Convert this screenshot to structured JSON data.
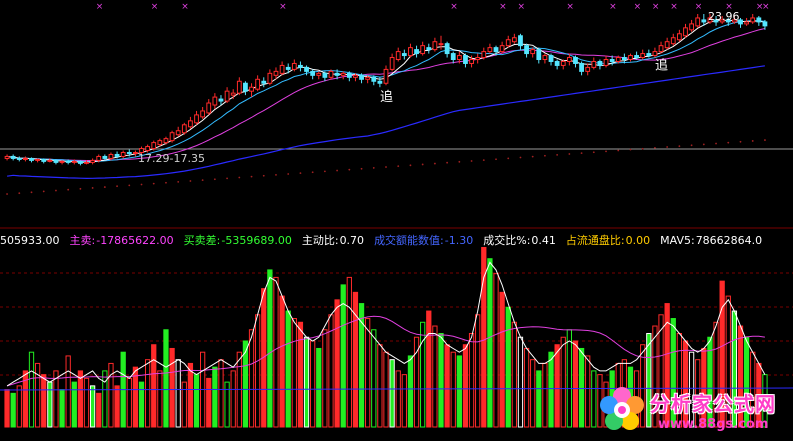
{
  "colors": {
    "up": "#ff2a2a",
    "down": "#55e6ff",
    "ma_white": "#ffffff",
    "ma_magenta": "#e040e0",
    "ma_blue": "#2a2aff",
    "ma_cyan": "#33bbff",
    "dots": "#a02020",
    "marker": "#e040e0",
    "label_white": "#ffffff",
    "label_magenta": "#ff44ff",
    "label_green": "#33ff33",
    "label_yellow": "#ffcc00",
    "label_blue": "#4466ff",
    "vol_green": "#22ee22",
    "vol_white": "#ffffff",
    "grid": "#7a0000"
  },
  "price_panel": {
    "annotations": [
      {
        "text": "追",
        "index": 62
      },
      {
        "text": "追",
        "index": 107
      }
    ],
    "range_label": "17.29-17.35",
    "high_label": "23.96"
  },
  "indicator_bar": {
    "items": [
      {
        "name": "prefix",
        "label": "",
        "value": "505933.00",
        "label_color": "#ffffff",
        "value_color": "#ffffff"
      },
      {
        "name": "main-sell",
        "label": "主卖:",
        "value": "-17865622.00",
        "label_color": "#ff44ff",
        "value_color": "#ff44ff"
      },
      {
        "name": "buy-sell-diff",
        "label": "买卖差:",
        "value": "-5359689.00",
        "label_color": "#33ff33",
        "value_color": "#33ff33"
      },
      {
        "name": "active-ratio",
        "label": "主动比:",
        "value": "0.70",
        "label_color": "#ffffff",
        "value_color": "#ffffff"
      },
      {
        "name": "deal-amount-index",
        "label": "成交额能数值:",
        "value": "-1.30",
        "label_color": "#4466ff",
        "value_color": "#4466ff"
      },
      {
        "name": "deal-ratio-pct",
        "label": "成交比%:",
        "value": "0.41",
        "label_color": "#ffffff",
        "value_color": "#ffffff"
      },
      {
        "name": "float-ratio",
        "label": "占流通盘比:",
        "value": "0.00",
        "label_color": "#ffcc00",
        "value_color": "#ffcc00"
      },
      {
        "name": "mav5",
        "label": "MAV5:",
        "value": "78662864.0",
        "label_color": "#ffffff",
        "value_color": "#ffffff"
      }
    ]
  },
  "watermark": {
    "cn": "分析家公式网",
    "url": "www.88gs.com"
  },
  "chart_data": [
    {
      "type": "candlestick",
      "panel": "price",
      "title": "",
      "ylim": [
        15.5,
        24.8
      ],
      "x_count": 125,
      "candles": [
        [
          17.5,
          17.6,
          17.7,
          17.4
        ],
        [
          17.6,
          17.5,
          17.7,
          17.4
        ],
        [
          17.5,
          17.45,
          17.6,
          17.35
        ],
        [
          17.45,
          17.5,
          17.6,
          17.35
        ],
        [
          17.5,
          17.4,
          17.55,
          17.3
        ],
        [
          17.4,
          17.45,
          17.5,
          17.3
        ],
        [
          17.45,
          17.35,
          17.5,
          17.25
        ],
        [
          17.35,
          17.4,
          17.5,
          17.3
        ],
        [
          17.4,
          17.3,
          17.45,
          17.2
        ],
        [
          17.3,
          17.35,
          17.4,
          17.2
        ],
        [
          17.35,
          17.3,
          17.45,
          17.2
        ],
        [
          17.3,
          17.35,
          17.45,
          17.2
        ],
        [
          17.35,
          17.25,
          17.4,
          17.15
        ],
        [
          17.25,
          17.3,
          17.4,
          17.2
        ],
        [
          17.3,
          17.4,
          17.5,
          17.2
        ],
        [
          17.4,
          17.6,
          17.7,
          17.3
        ],
        [
          17.6,
          17.5,
          17.7,
          17.4
        ],
        [
          17.5,
          17.7,
          17.8,
          17.4
        ],
        [
          17.7,
          17.6,
          17.85,
          17.5
        ],
        [
          17.6,
          17.8,
          17.9,
          17.5
        ],
        [
          17.8,
          17.75,
          17.95,
          17.6
        ],
        [
          17.75,
          17.8,
          17.9,
          17.6
        ],
        [
          17.8,
          18.0,
          18.1,
          17.7
        ],
        [
          17.9,
          18.1,
          18.2,
          17.8
        ],
        [
          18.0,
          18.3,
          18.4,
          17.9
        ],
        [
          18.2,
          18.4,
          18.5,
          18.1
        ],
        [
          18.3,
          18.5,
          18.6,
          18.2
        ],
        [
          18.4,
          18.8,
          18.9,
          18.3
        ],
        [
          18.7,
          18.9,
          19.1,
          18.6
        ],
        [
          18.8,
          19.2,
          19.3,
          18.7
        ],
        [
          19.1,
          19.4,
          19.6,
          19.0
        ],
        [
          19.3,
          19.7,
          19.9,
          19.2
        ],
        [
          19.6,
          19.9,
          20.1,
          19.5
        ],
        [
          19.8,
          20.3,
          20.5,
          19.7
        ],
        [
          20.2,
          20.6,
          20.8,
          20.0
        ],
        [
          20.5,
          20.4,
          20.7,
          20.2
        ],
        [
          20.4,
          20.9,
          21.1,
          20.3
        ],
        [
          20.7,
          20.8,
          21.0,
          20.5
        ],
        [
          20.8,
          21.4,
          21.6,
          20.7
        ],
        [
          21.3,
          20.9,
          21.4,
          20.7
        ],
        [
          20.9,
          21.1,
          21.3,
          20.6
        ],
        [
          21.0,
          21.5,
          21.7,
          20.9
        ],
        [
          21.4,
          21.3,
          21.6,
          21.1
        ],
        [
          21.3,
          21.8,
          22.0,
          21.2
        ],
        [
          21.7,
          21.9,
          22.1,
          21.5
        ],
        [
          21.8,
          22.2,
          22.4,
          21.7
        ],
        [
          22.1,
          22.0,
          22.3,
          21.8
        ],
        [
          22.0,
          22.3,
          22.5,
          21.9
        ],
        [
          22.2,
          22.1,
          22.4,
          21.9
        ],
        [
          22.1,
          21.9,
          22.2,
          21.7
        ],
        [
          21.9,
          21.7,
          22.0,
          21.5
        ],
        [
          21.7,
          21.8,
          21.9,
          21.5
        ],
        [
          21.8,
          21.6,
          21.9,
          21.4
        ],
        [
          21.6,
          21.9,
          22.0,
          21.5
        ],
        [
          21.8,
          21.7,
          22.0,
          21.5
        ],
        [
          21.7,
          21.8,
          21.9,
          21.5
        ],
        [
          21.8,
          21.6,
          21.9,
          21.4
        ],
        [
          21.6,
          21.7,
          21.8,
          21.4
        ],
        [
          21.7,
          21.5,
          21.8,
          21.3
        ],
        [
          21.5,
          21.6,
          21.7,
          21.3
        ],
        [
          21.6,
          21.4,
          21.7,
          21.2
        ],
        [
          21.4,
          21.3,
          21.6,
          21.1
        ],
        [
          21.3,
          22.0,
          22.2,
          21.2
        ],
        [
          22.0,
          22.6,
          22.8,
          21.9
        ],
        [
          22.5,
          22.9,
          23.1,
          22.4
        ],
        [
          22.8,
          22.7,
          23.0,
          22.5
        ],
        [
          22.7,
          23.1,
          23.3,
          22.6
        ],
        [
          23.0,
          22.8,
          23.2,
          22.6
        ],
        [
          22.8,
          23.2,
          23.4,
          22.7
        ],
        [
          23.1,
          23.0,
          23.3,
          22.8
        ],
        [
          23.0,
          23.4,
          23.6,
          22.9
        ],
        [
          23.3,
          23.3,
          23.7,
          23.0
        ],
        [
          23.3,
          22.8,
          23.4,
          22.6
        ],
        [
          22.8,
          22.5,
          22.9,
          22.3
        ],
        [
          22.5,
          22.7,
          22.9,
          22.3
        ],
        [
          22.7,
          22.3,
          22.8,
          22.1
        ],
        [
          22.3,
          22.5,
          22.7,
          22.1
        ],
        [
          22.5,
          22.6,
          22.8,
          22.3
        ],
        [
          22.6,
          22.9,
          23.1,
          22.5
        ],
        [
          22.9,
          23.1,
          23.3,
          22.8
        ],
        [
          23.1,
          22.9,
          23.2,
          22.7
        ],
        [
          22.9,
          23.2,
          23.4,
          22.8
        ],
        [
          23.2,
          23.5,
          23.7,
          23.1
        ],
        [
          23.4,
          23.6,
          23.8,
          23.3
        ],
        [
          23.7,
          23.2,
          23.8,
          23.0
        ],
        [
          23.2,
          22.8,
          23.3,
          22.6
        ],
        [
          22.8,
          23.0,
          23.1,
          22.6
        ],
        [
          23.0,
          22.5,
          23.1,
          22.3
        ],
        [
          22.5,
          22.7,
          22.8,
          22.3
        ],
        [
          22.7,
          22.4,
          22.8,
          22.2
        ],
        [
          22.4,
          22.2,
          22.5,
          22.0
        ],
        [
          22.2,
          22.4,
          22.5,
          22.0
        ],
        [
          22.4,
          22.6,
          22.8,
          22.2
        ],
        [
          22.6,
          22.3,
          22.7,
          22.1
        ],
        [
          22.3,
          21.9,
          22.4,
          21.7
        ],
        [
          21.9,
          22.1,
          22.3,
          21.7
        ],
        [
          22.1,
          22.4,
          22.6,
          22.0
        ],
        [
          22.4,
          22.2,
          22.5,
          22.0
        ],
        [
          22.2,
          22.5,
          22.7,
          22.1
        ],
        [
          22.5,
          22.4,
          22.7,
          22.2
        ],
        [
          22.4,
          22.6,
          22.7,
          22.3
        ],
        [
          22.6,
          22.5,
          22.8,
          22.3
        ],
        [
          22.5,
          22.7,
          22.8,
          22.4
        ],
        [
          22.7,
          22.6,
          22.9,
          22.5
        ],
        [
          22.6,
          22.8,
          23.0,
          22.5
        ],
        [
          22.8,
          22.7,
          23.0,
          22.6
        ],
        [
          22.7,
          22.9,
          23.1,
          22.6
        ],
        [
          22.9,
          23.2,
          23.4,
          22.8
        ],
        [
          23.1,
          23.4,
          23.6,
          23.0
        ],
        [
          23.3,
          23.6,
          23.8,
          23.2
        ],
        [
          23.5,
          23.8,
          24.0,
          23.4
        ],
        [
          23.7,
          24.1,
          24.3,
          23.6
        ],
        [
          24.0,
          24.3,
          24.5,
          23.9
        ],
        [
          24.2,
          24.6,
          24.8,
          24.1
        ],
        [
          24.5,
          24.4,
          24.8,
          24.2
        ],
        [
          24.4,
          24.6,
          24.8,
          24.3
        ],
        [
          24.5,
          24.4,
          24.7,
          24.2
        ],
        [
          24.4,
          24.5,
          24.7,
          24.3
        ],
        [
          24.5,
          24.4,
          24.6,
          24.2
        ],
        [
          24.4,
          24.5,
          24.7,
          24.3
        ],
        [
          24.5,
          24.3,
          24.6,
          24.1
        ],
        [
          24.3,
          24.4,
          24.6,
          24.2
        ],
        [
          24.4,
          24.6,
          24.8,
          24.3
        ],
        [
          24.6,
          24.4,
          24.7,
          24.2
        ],
        [
          24.4,
          24.2,
          24.5,
          24.0
        ]
      ]
    },
    {
      "type": "bar",
      "panel": "volume",
      "title": "",
      "ylim": [
        0,
        100
      ],
      "values": [
        20,
        18,
        22,
        30,
        40,
        34,
        28,
        24,
        30,
        20,
        38,
        24,
        30,
        26,
        22,
        18,
        30,
        34,
        22,
        40,
        26,
        32,
        24,
        36,
        44,
        30,
        52,
        42,
        36,
        24,
        34,
        28,
        40,
        26,
        32,
        36,
        24,
        30,
        40,
        46,
        52,
        60,
        74,
        84,
        80,
        70,
        62,
        58,
        56,
        48,
        46,
        42,
        52,
        60,
        68,
        76,
        80,
        72,
        66,
        58,
        52,
        44,
        40,
        36,
        30,
        28,
        38,
        48,
        56,
        62,
        54,
        50,
        44,
        40,
        38,
        44,
        50,
        60,
        96,
        90,
        82,
        72,
        64,
        56,
        48,
        42,
        36,
        30,
        34,
        40,
        44,
        48,
        52,
        46,
        42,
        38,
        30,
        28,
        24,
        30,
        34,
        36,
        32,
        30,
        44,
        50,
        54,
        60,
        66,
        58,
        50,
        46,
        40,
        36,
        42,
        48,
        56,
        78,
        70,
        62,
        54,
        48,
        40,
        34,
        28
      ],
      "up": [
        1,
        0,
        1,
        1,
        0,
        1,
        1,
        0,
        1,
        0,
        1,
        0,
        1,
        1,
        0,
        1,
        0,
        1,
        1,
        0,
        1,
        1,
        0,
        1,
        1,
        1,
        0,
        1,
        0,
        1,
        1,
        0,
        1,
        1,
        0,
        1,
        0,
        1,
        1,
        0,
        1,
        1,
        1,
        0,
        1,
        1,
        0,
        1,
        1,
        0,
        1,
        0,
        1,
        1,
        1,
        0,
        1,
        1,
        0,
        1,
        0,
        1,
        1,
        0,
        1,
        1,
        0,
        1,
        0,
        1,
        1,
        0,
        1,
        1,
        0,
        1,
        1,
        1,
        1,
        0,
        1,
        1,
        0,
        1,
        0,
        1,
        1,
        0,
        1,
        0,
        1,
        1,
        0,
        1,
        0,
        1,
        0,
        1,
        1,
        0,
        1,
        1,
        0,
        1,
        1,
        0,
        1,
        1,
        1,
        0,
        1,
        1,
        0,
        1,
        1,
        0,
        1,
        1,
        1,
        0,
        1,
        0,
        1,
        1,
        0
      ],
      "mav5": [
        22,
        24,
        26,
        28,
        30,
        28,
        26,
        24,
        26,
        28,
        30,
        28,
        26,
        28,
        30,
        26,
        24,
        28,
        30,
        28,
        26,
        30,
        32,
        34,
        36,
        34,
        32,
        34,
        36,
        34,
        30,
        28,
        30,
        32,
        34,
        36,
        34,
        32,
        36,
        40,
        48,
        60,
        72,
        80,
        78,
        70,
        62,
        56,
        52,
        48,
        46,
        48,
        54,
        60,
        64,
        66,
        64,
        60,
        56,
        52,
        48,
        44,
        40,
        38,
        36,
        34,
        36,
        40,
        46,
        50,
        50,
        48,
        44,
        42,
        40,
        42,
        48,
        62,
        80,
        88,
        84,
        76,
        66,
        56,
        48,
        42,
        38,
        34,
        34,
        36,
        40,
        44,
        46,
        44,
        40,
        36,
        32,
        30,
        30,
        32,
        34,
        34,
        34,
        36,
        40,
        44,
        48,
        52,
        56,
        54,
        50,
        46,
        42,
        40,
        42,
        46,
        54,
        64,
        68,
        62,
        54,
        46,
        40,
        34,
        28
      ]
    }
  ]
}
